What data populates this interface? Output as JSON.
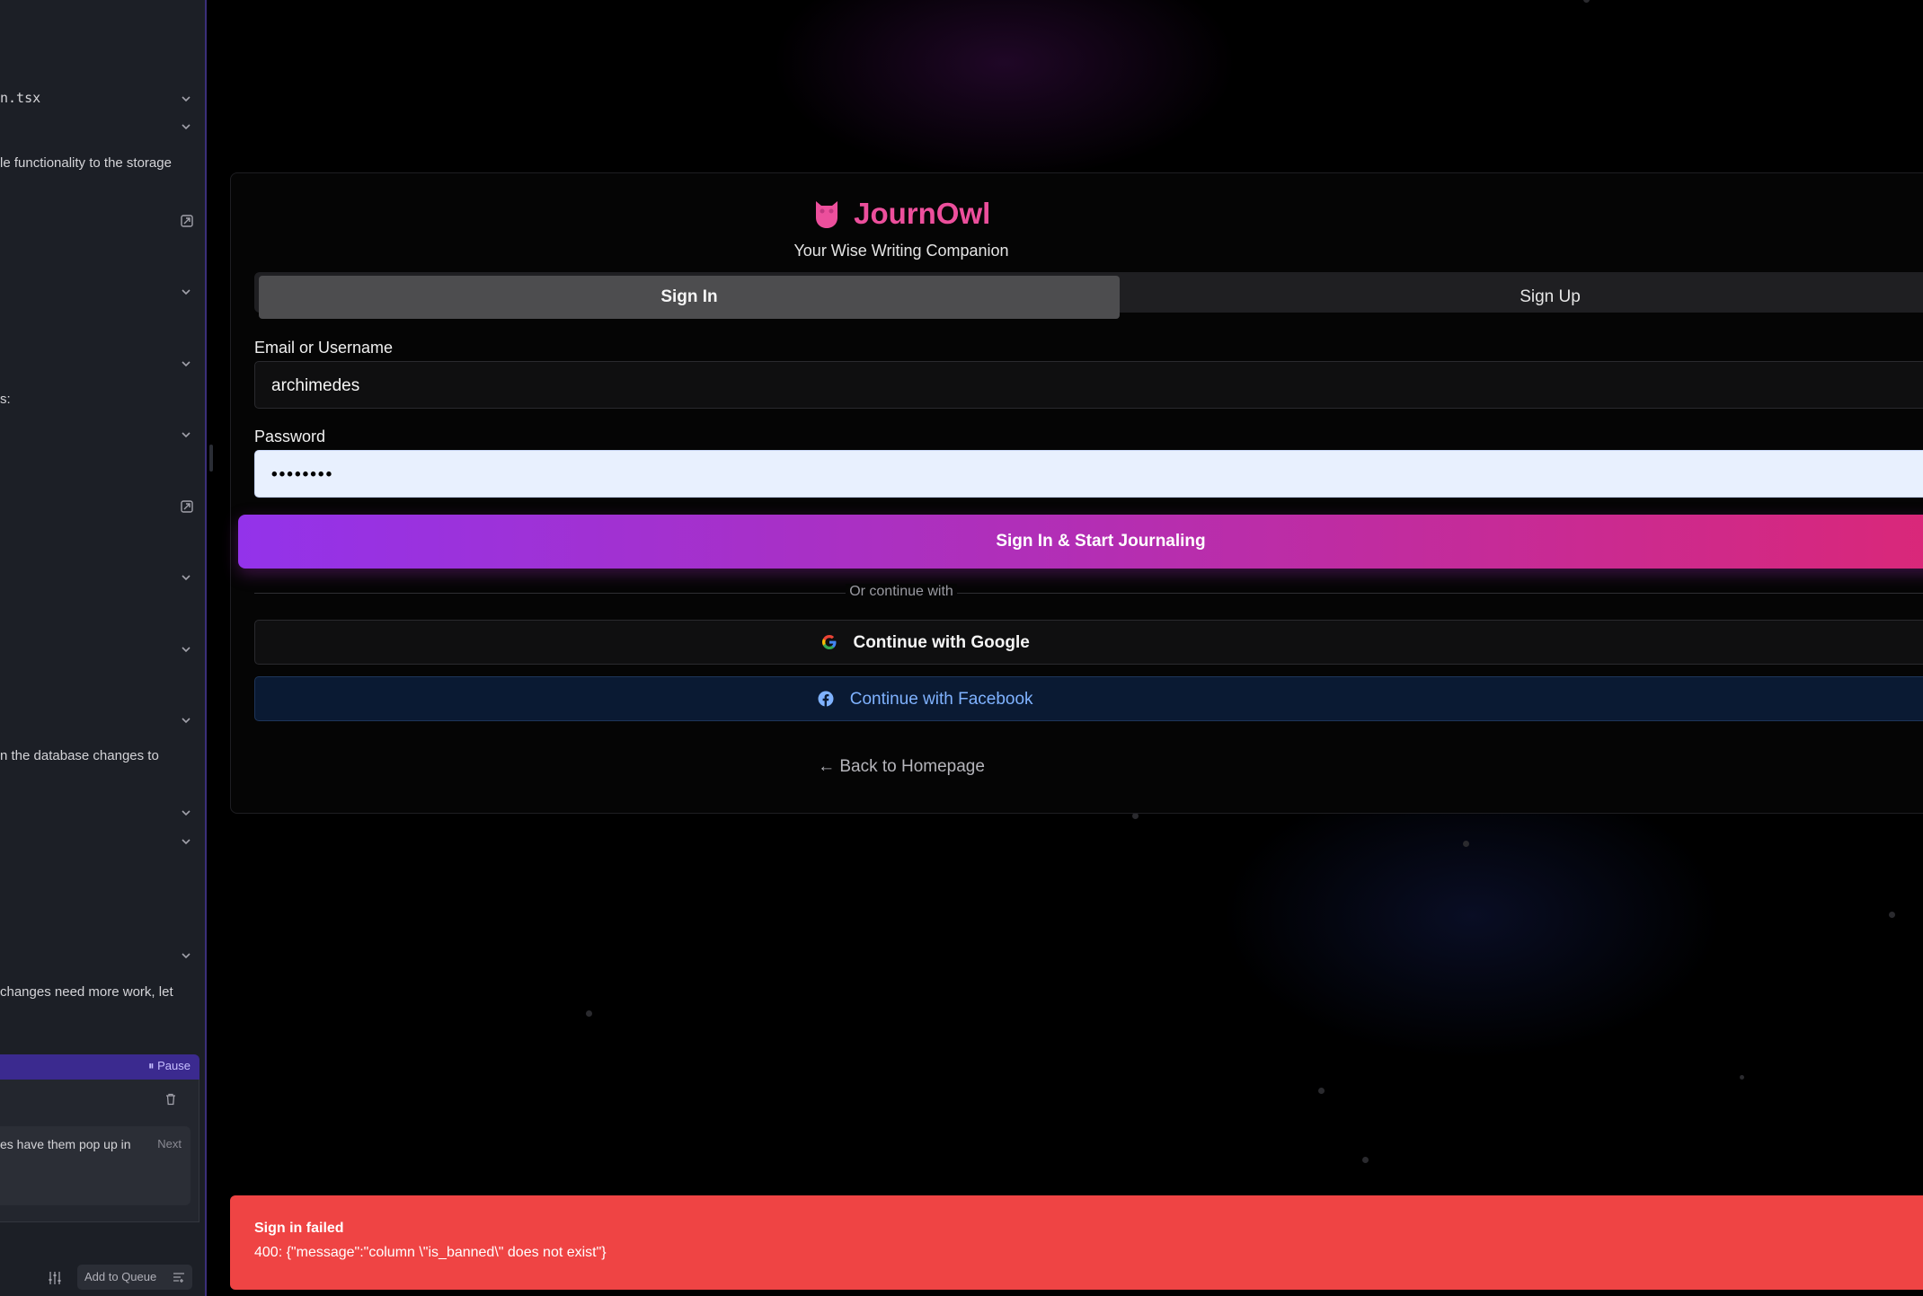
{
  "sidebar": {
    "items": [
      {
        "text": "n.tsx",
        "mono": true
      },
      {
        "text": "le functionality to the storage"
      },
      {
        "text": "s:"
      },
      {
        "text": "n the database changes to"
      },
      {
        "text": "changes need more work, let"
      }
    ],
    "queue": {
      "pause_label": "Pause",
      "item_text": "es have them pop up in",
      "next_label": "Next",
      "add_label": "Add to Queue"
    }
  },
  "auth": {
    "brand_name": "JournOwl",
    "tagline": "Your Wise Writing Companion",
    "tabs": {
      "sign_in": "Sign In",
      "sign_up": "Sign Up"
    },
    "email_label": "Email or Username",
    "email_value": "archimedes",
    "password_label": "Password",
    "password_value": "••••••••",
    "submit_label": "Sign In & Start Journaling",
    "divider_text": "Or continue with",
    "google_label": "Continue with Google",
    "facebook_label": "Continue with Facebook",
    "back_label": "← Back to Homepage"
  },
  "toast": {
    "title": "Sign in failed",
    "message": "400: {\"message\":\"column \\\"is_banned\\\" does not exist\"}"
  },
  "colors": {
    "brand_pink": "#ec4f9c",
    "button_gradient_start": "#9333ea",
    "button_gradient_end": "#db2777",
    "toast_red": "#ef4444",
    "facebook_blue": "#7fb2ff"
  }
}
